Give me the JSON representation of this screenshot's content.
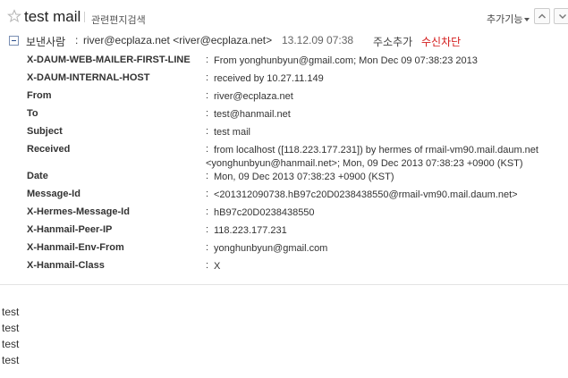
{
  "subject_bar": {
    "title": "test mail",
    "related_search": "관련편지검색",
    "more_functions": "추가기능",
    "star_icon": "star-outline-icon",
    "prev_icon": "arrow-up-icon",
    "next_icon": "arrow-down-icon"
  },
  "sender": {
    "label": "보낸사람",
    "colon": ":",
    "value": "river@ecplaza.net <river@ecplaza.net>",
    "date": "13.12.09 07:38",
    "add_contact": "주소추가",
    "block": "수신차단",
    "block_color": "#d31b1b"
  },
  "headers": [
    {
      "name": "X-DAUM-WEB-MAILER-FIRST-LINE",
      "colon": ":",
      "value": "From yonghunbyun@gmail.com; Mon Dec 09 07:38:23 2013"
    },
    {
      "name": "X-DAUM-INTERNAL-HOST",
      "colon": ":",
      "value": "received by 10.27.11.149"
    },
    {
      "name": "From",
      "colon": ":",
      "value": "river@ecplaza.net"
    },
    {
      "name": "To",
      "colon": ":",
      "value": "test@hanmail.net"
    },
    {
      "name": "Subject",
      "colon": ":",
      "value": "test mail"
    },
    {
      "name": "Received",
      "colon": ":",
      "value": "from localhost ([118.223.177.231]) by hermes of rmail-vm90.mail.daum.net",
      "value2": "<yonghunbyun@hanmail.net>; Mon, 09 Dec 2013 07:38:23 +0900 (KST)"
    },
    {
      "name": "Date",
      "colon": ":",
      "value": "Mon, 09 Dec 2013 07:38:23 +0900 (KST)"
    },
    {
      "name": "Message-Id",
      "colon": ":",
      "value": "<201312090738.hB97c20D0238438550@rmail-vm90.mail.daum.net>"
    },
    {
      "name": "X-Hermes-Message-Id",
      "colon": ":",
      "value": "hB97c20D0238438550"
    },
    {
      "name": "X-Hanmail-Peer-IP",
      "colon": ":",
      "value": "118.223.177.231"
    },
    {
      "name": "X-Hanmail-Env-From",
      "colon": ":",
      "value": "yonghunbyun@gmail.com"
    },
    {
      "name": "X-Hanmail-Class",
      "colon": ":",
      "value": "X"
    }
  ],
  "body_lines": [
    "test",
    "test",
    "test",
    "test"
  ]
}
